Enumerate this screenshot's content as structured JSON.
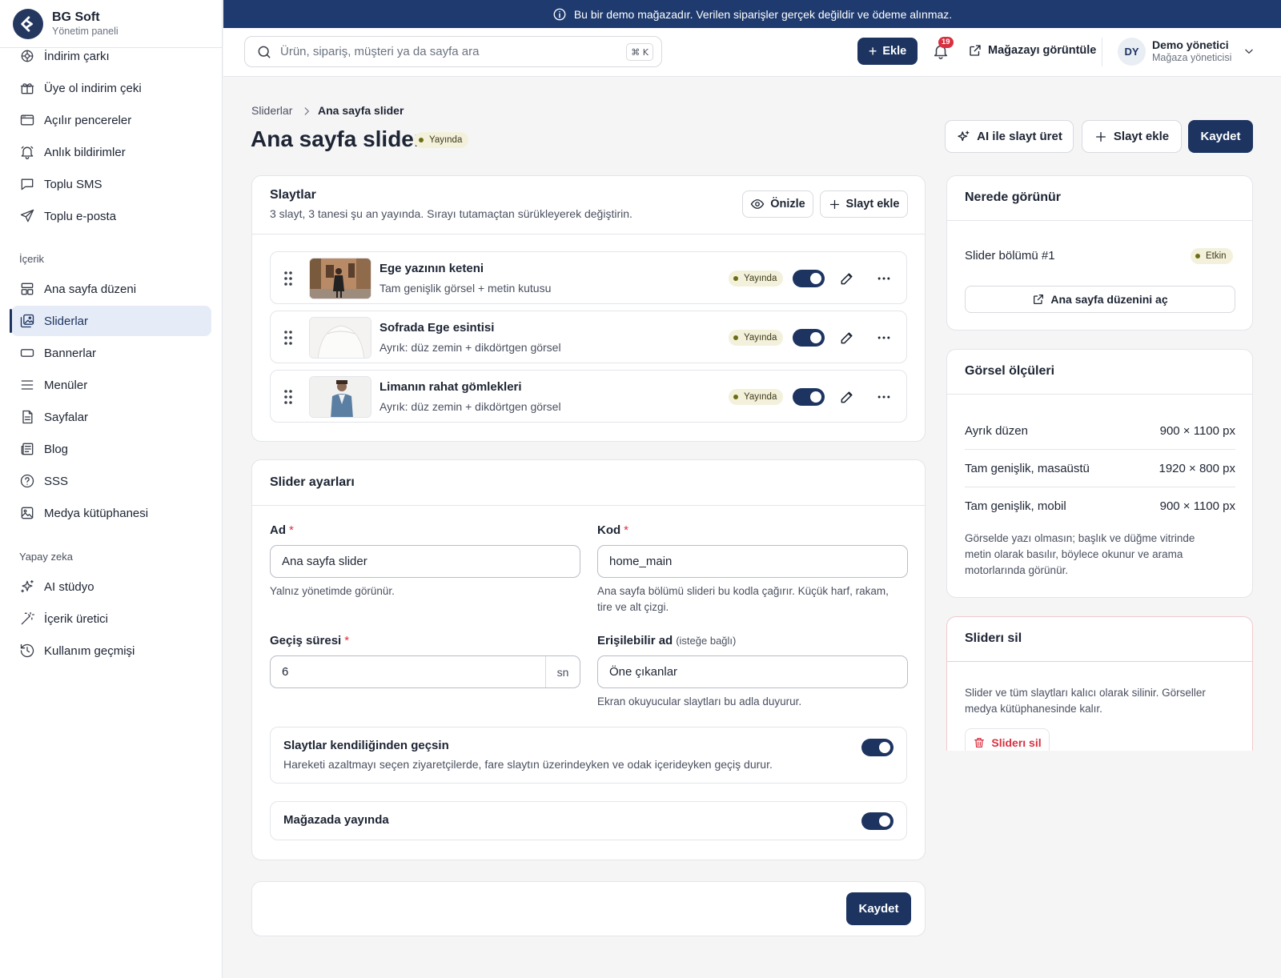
{
  "banner": {
    "text": "Bu bir demo mağazadır. Verilen siparişler gerçek değildir ve ödeme alınmaz."
  },
  "brand": {
    "name": "BG Soft",
    "subtitle": "Yönetim paneli"
  },
  "sidebar": {
    "items_top": [
      {
        "label": "İndirim çarkı",
        "icon": "wheel-icon"
      },
      {
        "label": "Üye ol indirim çeki",
        "icon": "gift-icon"
      },
      {
        "label": "Açılır pencereler",
        "icon": "window-icon"
      },
      {
        "label": "Anlık bildirimler",
        "icon": "bell-icon"
      },
      {
        "label": "Toplu SMS",
        "icon": "message-icon"
      },
      {
        "label": "Toplu e-posta",
        "icon": "send-icon"
      }
    ],
    "section_content": "İçerik",
    "items_content": [
      {
        "label": "Ana sayfa düzeni",
        "icon": "layout-icon"
      },
      {
        "label": "Sliderlar",
        "icon": "images-icon",
        "active": true
      },
      {
        "label": "Bannerlar",
        "icon": "banner-icon"
      },
      {
        "label": "Menüler",
        "icon": "menu-icon"
      },
      {
        "label": "Sayfalar",
        "icon": "file-icon"
      },
      {
        "label": "Blog",
        "icon": "newspaper-icon"
      },
      {
        "label": "SSS",
        "icon": "help-icon"
      },
      {
        "label": "Medya kütüphanesi",
        "icon": "image-icon"
      }
    ],
    "section_ai": "Yapay zeka",
    "items_ai": [
      {
        "label": "AI stüdyo",
        "icon": "sparkles-icon"
      },
      {
        "label": "İçerik üretici",
        "icon": "wand-icon"
      },
      {
        "label": "Kullanım geçmişi",
        "icon": "history-icon"
      }
    ]
  },
  "topbar": {
    "search_placeholder": "Ürün, sipariş, müşteri ya da sayfa ara",
    "search_shortcut": "⌘ K",
    "add_label": "Ekle",
    "notification_count": "19",
    "view_store_label": "Mağazayı görüntüle",
    "user": {
      "initials": "DY",
      "name": "Demo yönetici",
      "role": "Mağaza yöneticisi"
    }
  },
  "breadcrumb": {
    "parent": "Sliderlar",
    "current": "Ana sayfa slider"
  },
  "page": {
    "title": "Ana sayfa slider",
    "status": "Yayında",
    "ai_button": "AI ile slayt üret",
    "add_slide_button": "Slayt ekle",
    "save_button": "Kaydet"
  },
  "slides_card": {
    "title": "Slaytlar",
    "subtitle": "3 slayt, 3 tanesi şu an yayında. Sırayı tutamaçtan sürükleyerek değiştirin.",
    "preview_button": "Önizle",
    "add_button": "Slayt ekle",
    "slides": [
      {
        "title": "Ege yazının keteni",
        "subtitle": "Tam genişlik görsel + metin kutusu",
        "status": "Yayında",
        "enabled": true
      },
      {
        "title": "Sofrada Ege esintisi",
        "subtitle": "Ayrık: düz zemin + dikdörtgen görsel",
        "status": "Yayında",
        "enabled": true
      },
      {
        "title": "Limanın rahat gömlekleri",
        "subtitle": "Ayrık: düz zemin + dikdörtgen görsel",
        "status": "Yayında",
        "enabled": true
      }
    ]
  },
  "settings_card": {
    "title": "Slider ayarları",
    "name_label": "Ad",
    "name_value": "Ana sayfa slider",
    "name_hint": "Yalnız yönetimde görünür.",
    "code_label": "Kod",
    "code_value": "home_main",
    "code_hint_1": "Ana sayfa bölümü slideri bu kodla çağırır. Küçük harf, rakam,",
    "code_hint_2": "tire ve alt çizgi.",
    "duration_label": "Geçiş süresi",
    "duration_value": "6",
    "duration_unit": "sn",
    "a11y_label": "Erişilebilir ad",
    "a11y_optional": "(isteğe bağlı)",
    "a11y_value": "Öne çıkanlar",
    "a11y_hint": "Ekran okuyucular slaytları bu adla duyurur.",
    "autoplay_title": "Slaytlar kendiliğinden geçsin",
    "autoplay_desc": "Hareketi azaltmayı seçen ziyaretçilerde, fare slaytın üzerindeyken ve odak içerideyken geçiş durur.",
    "autoplay_on": true,
    "published_title": "Mağazada yayında",
    "published_on": true
  },
  "footer": {
    "save_button": "Kaydet"
  },
  "where_card": {
    "title": "Nerede görünür",
    "section": "Slider bölümü #1",
    "section_status": "Etkin",
    "open_button": "Ana sayfa düzenini aç"
  },
  "dims_card": {
    "title": "Görsel ölçüleri",
    "rows": [
      {
        "label": "Ayrık düzen",
        "value": "900 × 1100 px"
      },
      {
        "label": "Tam genişlik, masaüstü",
        "value": "1920 × 800 px"
      },
      {
        "label": "Tam genişlik, mobil",
        "value": "900 × 1100 px"
      }
    ],
    "note_1": "Görselde yazı olmasın; başlık ve düğme vitrinde",
    "note_2": "metin olarak basılır, böylece okunur ve arama",
    "note_3": "motorlarında görünür."
  },
  "delete_card": {
    "title": "Sliderı sil",
    "desc_1": "Slider ve tüm slaytları kalıcı olarak silinir. Görseller",
    "desc_2": "medya kütüphanesinde kalır.",
    "button": "Sliderı sil"
  },
  "colors": {
    "primary": "#1d3461",
    "banner": "#1e3a6e",
    "danger": "#d93040",
    "status_bg": "#f3f1dc"
  }
}
